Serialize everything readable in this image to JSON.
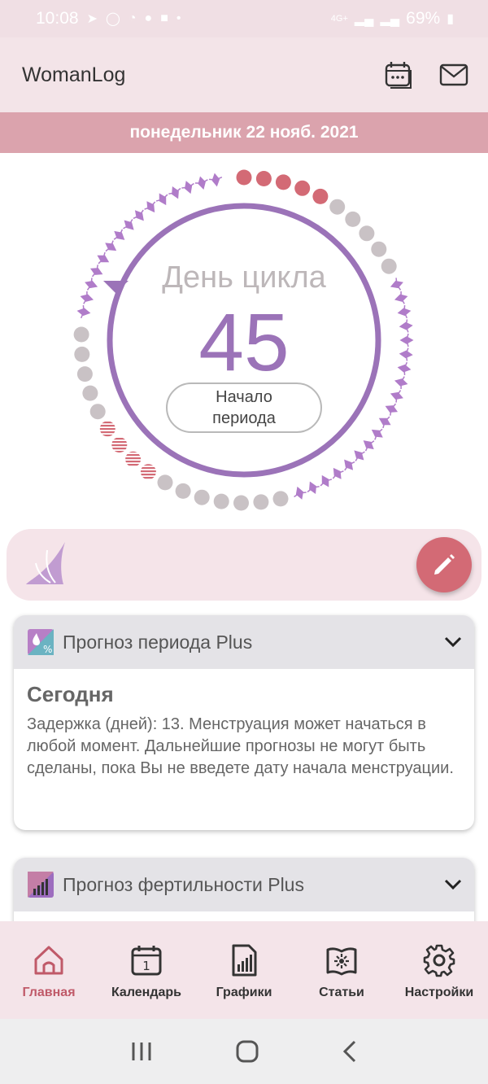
{
  "status_bar": {
    "time": "10:08",
    "signal_label": "4G+",
    "battery": "69%"
  },
  "app_bar": {
    "title": "WomanLog"
  },
  "date_bar": {
    "date": "понедельник 22 нояб. 2021"
  },
  "cycle": {
    "label": "День цикла",
    "day": "45",
    "period_button_line1": "Начало",
    "period_button_line2": "периода",
    "colors": {
      "ring": "#9b73b8",
      "period": "#d36a75",
      "neutral": "#c9c2c5",
      "fertile": "#b07cc9"
    }
  },
  "cards": [
    {
      "title": "Прогноз периода Plus",
      "subtitle": "Сегодня",
      "text": "Задержка (дней): 13. Менструация может начаться в любой момент. Дальнейшие прогнозы не могут быть сделаны, пока Вы не введете дату начала менструации."
    },
    {
      "title": "Прогноз фертильности Plus"
    }
  ],
  "bottom_nav": [
    {
      "label": "Главная",
      "icon": "home-icon",
      "active": true
    },
    {
      "label": "Календарь",
      "icon": "calendar-icon",
      "active": false
    },
    {
      "label": "Графики",
      "icon": "charts-icon",
      "active": false
    },
    {
      "label": "Статьи",
      "icon": "articles-icon",
      "active": false
    },
    {
      "label": "Настройки",
      "icon": "settings-icon",
      "active": false
    }
  ],
  "accent_color": "#c05a69"
}
